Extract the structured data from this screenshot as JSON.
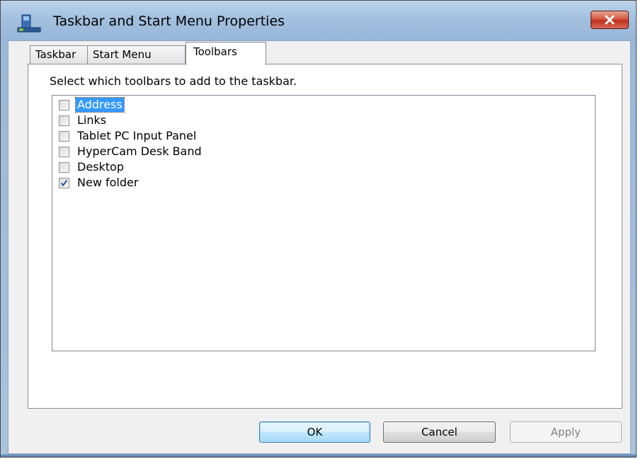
{
  "window": {
    "title": "Taskbar and Start Menu Properties",
    "app_icon": "taskbar-properties-icon",
    "close_icon": "close-icon"
  },
  "tabs": [
    {
      "label": "Taskbar",
      "active": false
    },
    {
      "label": "Start Menu",
      "active": false
    },
    {
      "label": "Toolbars",
      "active": true
    }
  ],
  "panel": {
    "instruction": "Select which toolbars to add to the taskbar.",
    "toolbars": [
      {
        "label": "Address",
        "checked": false,
        "selected": true
      },
      {
        "label": "Links",
        "checked": false,
        "selected": false
      },
      {
        "label": "Tablet PC Input Panel",
        "checked": false,
        "selected": false
      },
      {
        "label": "HyperCam Desk Band",
        "checked": false,
        "selected": false
      },
      {
        "label": "Desktop",
        "checked": false,
        "selected": false
      },
      {
        "label": "New folder",
        "checked": true,
        "selected": false
      }
    ]
  },
  "buttons": {
    "ok": "OK",
    "cancel": "Cancel",
    "apply": "Apply",
    "apply_enabled": false
  },
  "colors": {
    "selection": "#3399ff",
    "titlebar": "#a3c0df",
    "close_button": "#c0321b"
  }
}
